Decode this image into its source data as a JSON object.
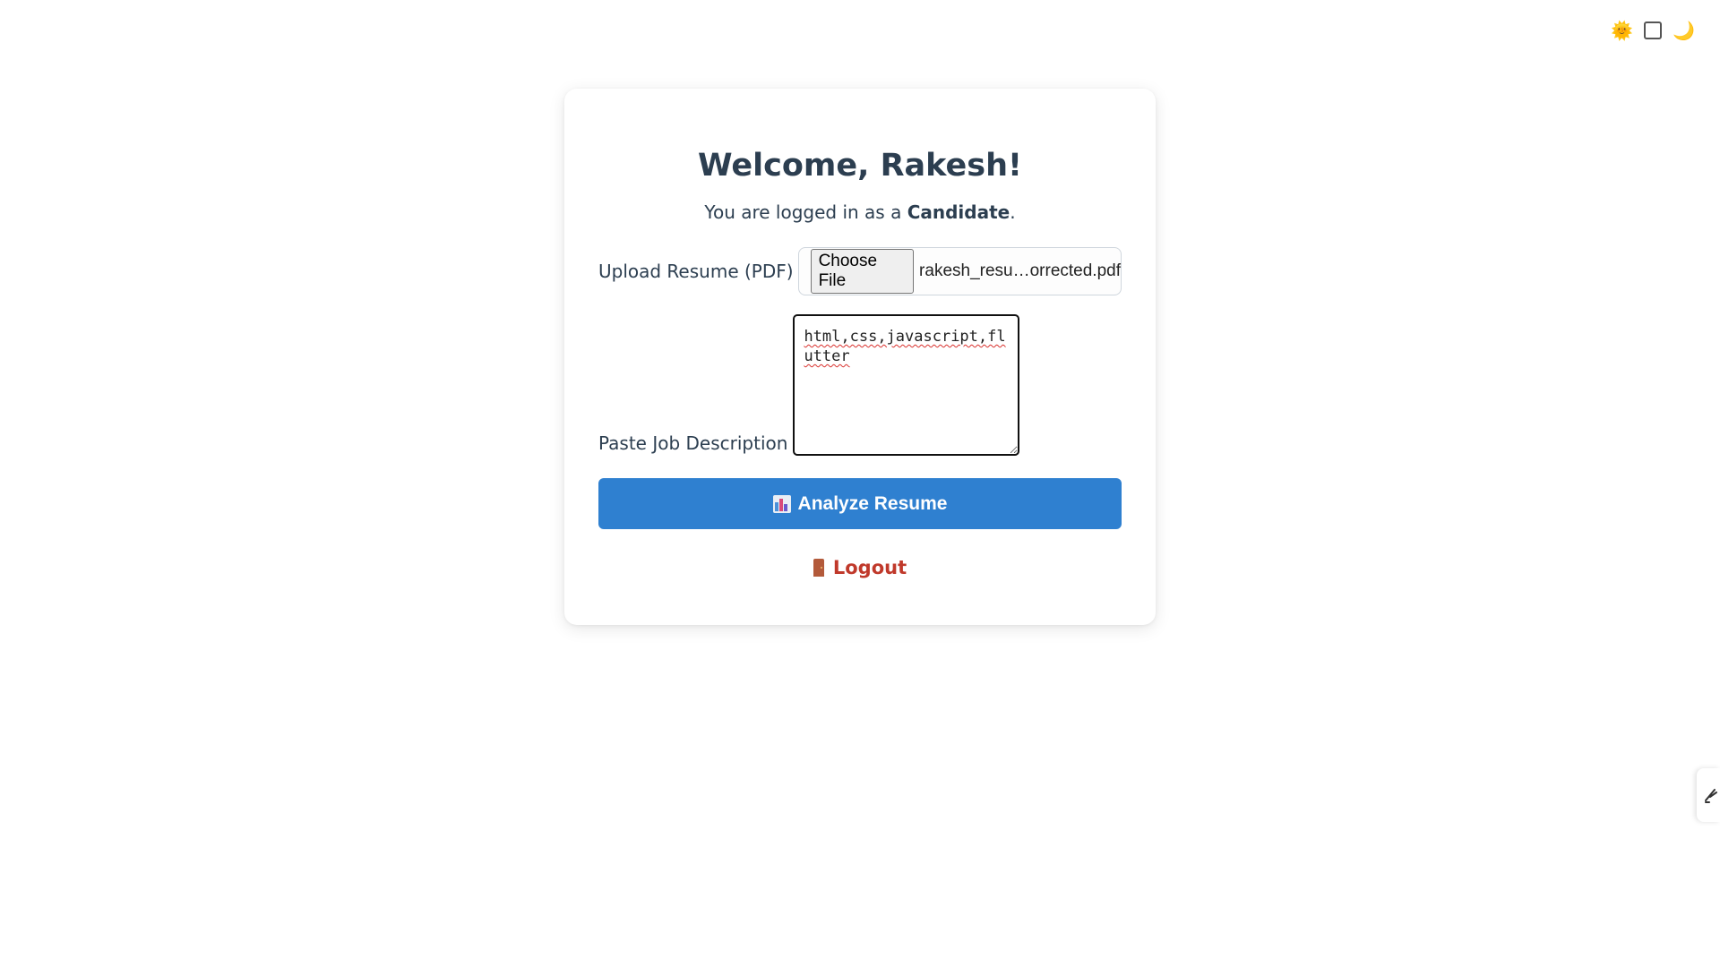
{
  "theme_toggle": {
    "sun_icon": "sun-emoji-icon",
    "moon_icon": "moon-icon",
    "sun_glyph": "🌞",
    "moon_glyph": "🌙"
  },
  "card": {
    "title": "Welcome, Rakesh!",
    "subtitle_prefix": "You are logged in as a ",
    "role": "Candidate",
    "subtitle_suffix": "."
  },
  "upload": {
    "label": "Upload Resume (PDF)",
    "button_label": "Choose File",
    "file_name": "rakesh_resu…orrected.pdf"
  },
  "job_description": {
    "label": "Paste Job Description",
    "value": "html,css,javascript,flutter"
  },
  "analyze_button": {
    "label": "Analyze Resume",
    "icon": "bar-chart-icon"
  },
  "logout": {
    "label": "Logout",
    "icon": "door-icon"
  },
  "colors": {
    "accent": "#2f80d0",
    "logout": "#c0392b",
    "text": "#2c3e50"
  }
}
